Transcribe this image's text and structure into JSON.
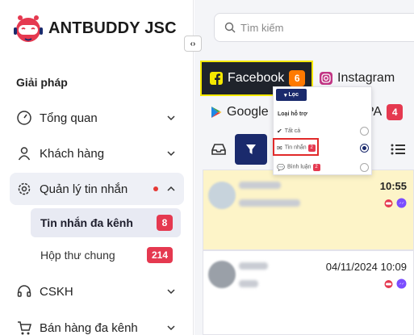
{
  "brand": {
    "name": "ANTBUDDY JSC"
  },
  "sidebar": {
    "section_title": "Giải pháp",
    "items": [
      {
        "label": "Tổng quan",
        "icon": "gauge-icon"
      },
      {
        "label": "Khách hàng",
        "icon": "user-icon"
      },
      {
        "label": "Quản lý tin nhắn",
        "icon": "message-settings-icon",
        "active": true,
        "has_dot": true
      },
      {
        "label": "CSKH",
        "icon": "headset-icon"
      },
      {
        "label": "Bán hàng đa kênh",
        "icon": "cart-icon"
      }
    ],
    "sub_items": [
      {
        "label": "Tin nhắn đa kênh",
        "count": "8",
        "active": true
      },
      {
        "label": "Hộp thư chung",
        "count": "214"
      }
    ]
  },
  "search": {
    "placeholder": "Tìm kiếm"
  },
  "channels": {
    "facebook": {
      "label": "Facebook",
      "count": "6"
    },
    "instagram": {
      "label": "Instagram"
    },
    "google": {
      "label": "Google"
    },
    "zalo": {
      "label": "PA",
      "count": "4"
    }
  },
  "filter_popup": {
    "button": "Lọc",
    "title": "Loại hỗ trợ",
    "options": [
      {
        "label": "Tất cả"
      },
      {
        "label": "Tin nhắn",
        "count": "2",
        "selected": true
      },
      {
        "label": "Bình luận",
        "count": "2"
      }
    ]
  },
  "conversations": [
    {
      "time": "10:55",
      "selected": true
    },
    {
      "time": "04/11/2024 10:09"
    }
  ],
  "colors": {
    "accent": "#1a2a6c",
    "badge": "#e53950",
    "facebook_badge": "#ff7a00",
    "selected_row": "#fdf4c8"
  }
}
